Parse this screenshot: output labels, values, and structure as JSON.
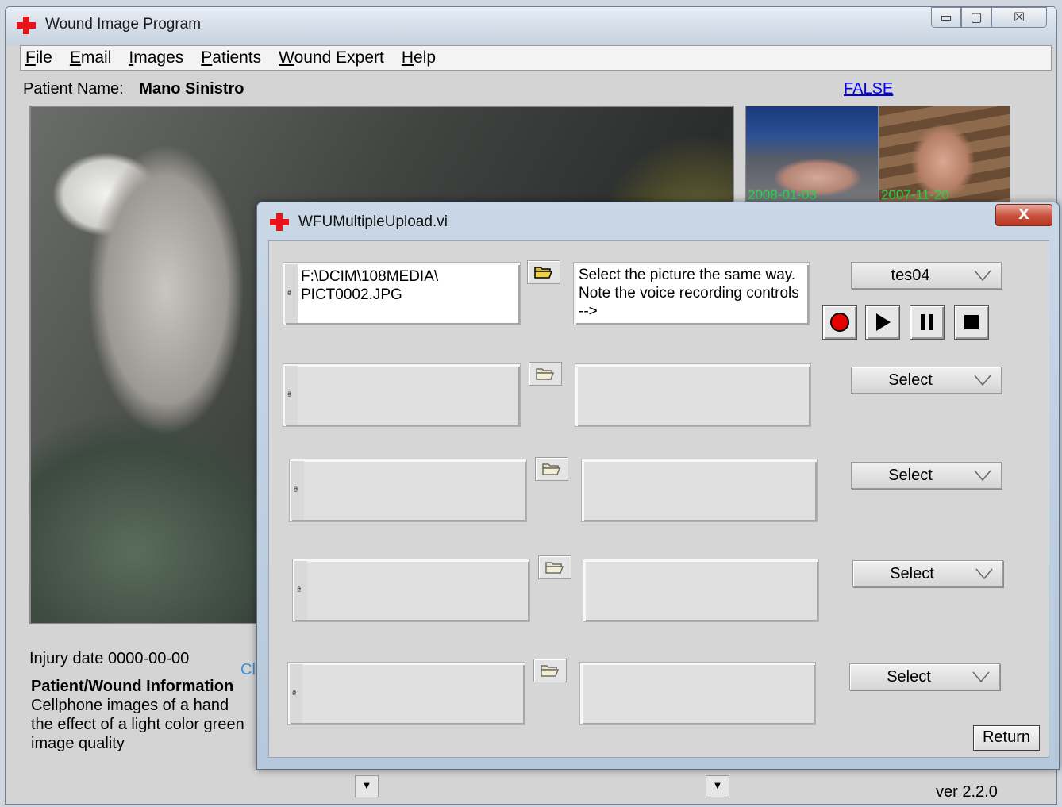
{
  "main_window": {
    "title": "Wound Image Program",
    "caption_buttons": {
      "minimize": "▭",
      "maximize": "▢",
      "close": "☒"
    },
    "menu": [
      "File",
      "Email",
      "Images",
      "Patients",
      "Wound Expert",
      "Help"
    ],
    "patient_label": "Patient Name:",
    "patient_name": "Mano Sinistro",
    "link_text": "FALSE",
    "thumbnails": [
      {
        "date": "2008-01-03"
      },
      {
        "date": "2007-11-20"
      }
    ],
    "injury_date_label": "Injury date",
    "injury_date_value": "0000-00-00",
    "info_heading": "Patient/Wound Information",
    "info_lines": [
      "Cellphone images of a hand",
      "the effect of a light color green",
      "image quality"
    ],
    "hidden_fragment": "Cl",
    "version": "ver 2.2.0"
  },
  "dialog": {
    "title": "WFUMultipleUpload.vi",
    "close_label": "X",
    "rows": [
      {
        "path": "F:\\DCIM\\108MEDIA\\\nPICT0002.JPG",
        "note": "Select the picture the same way. Note the voice recording controls -->",
        "select": "tes04"
      },
      {
        "path": "",
        "note": "",
        "select": "Select"
      },
      {
        "path": "",
        "note": "",
        "select": "Select"
      },
      {
        "path": "",
        "note": "",
        "select": "Select"
      },
      {
        "path": "",
        "note": "",
        "select": "Select"
      }
    ],
    "recording_controls": [
      "record",
      "play",
      "pause",
      "stop"
    ],
    "return_label": "Return"
  },
  "colors": {
    "red_cross": "#e8141a",
    "link": "#0000ee",
    "thumb_date": "#22d94a"
  }
}
